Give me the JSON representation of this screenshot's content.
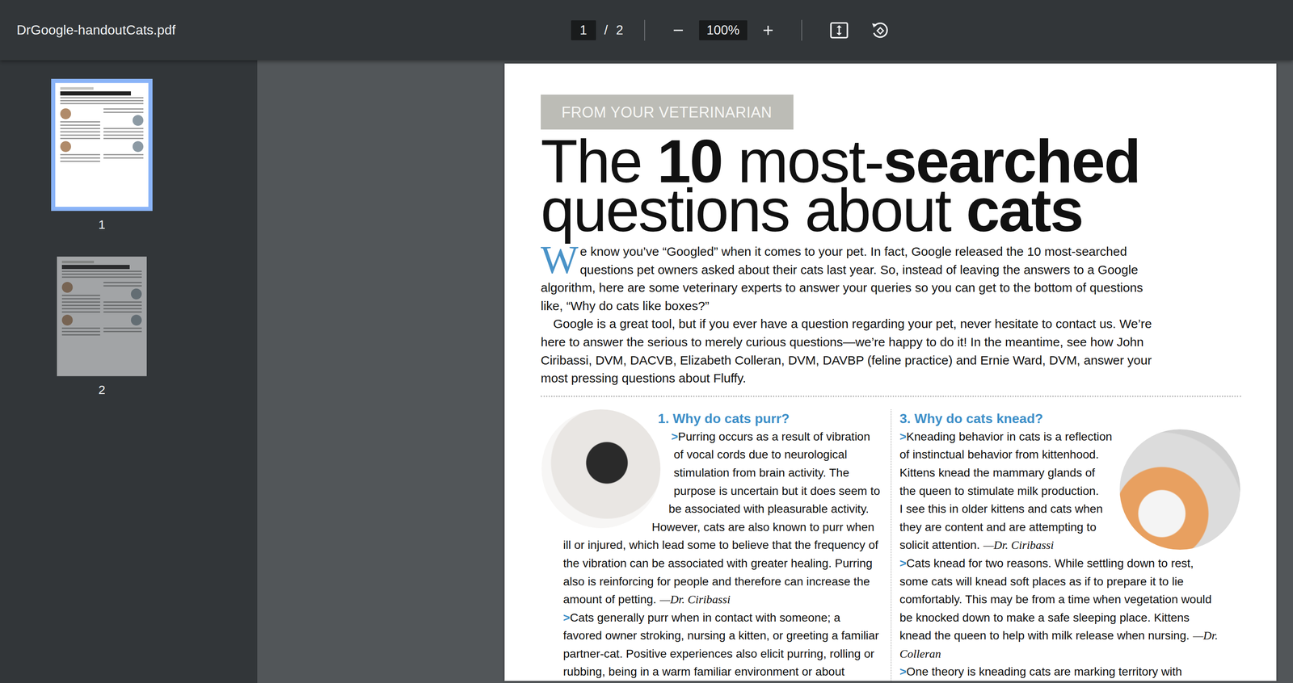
{
  "window": {
    "title": "DrGoogle-handoutCats.pdf"
  },
  "toolbar": {
    "page": "1",
    "page_separator": "/",
    "page_total": "2",
    "zoom": "100%"
  },
  "sidebar": {
    "thumbnails": [
      {
        "label": "1",
        "selected": true
      },
      {
        "label": "2",
        "selected": false
      }
    ]
  },
  "document": {
    "banner": "FROM YOUR VETERINARIAN",
    "title_lines": [
      [
        {
          "text": "The ",
          "bold": false
        },
        {
          "text": "10",
          "bold": true
        },
        {
          "text": " most-",
          "bold": false
        },
        {
          "text": "searched",
          "bold": true
        }
      ],
      [
        {
          "text": "questions about ",
          "bold": false
        },
        {
          "text": "cats",
          "bold": true
        }
      ]
    ],
    "intro": [
      "We know you’ve “Googled” when it comes to your pet. In fact, Google released the 10 most-searched questions pet owners asked about their cats last year. So, instead of leaving the answers to a Google algorithm, here are some veterinary experts to answer your queries so you can get to the bottom of questions like, “Why do cats like boxes?”",
      "Google is a great tool, but if you ever have a question regarding your pet, never hesitate to contact us. We’re here to answer the serious to merely curious questions—we’re happy to do it! In the meantime, see how John Ciribassi, DVM, DACVB, Elizabeth Colleran, DVM, DAVBP (feline practice) and Ernie Ward, DVM, answer your most pressing questions about Fluffy."
    ],
    "columns": [
      {
        "heading": "1. Why do cats purr?",
        "photo_side": "left",
        "answers": [
          {
            "marker": ">",
            "text": "Purring occurs as a result of vibration of vocal cords due to neurological stimulation from brain activity. The purpose is uncertain but it does seem to be associated with pleasurable activity. However, cats are also known to purr when ill or injured, which lead some to believe that the frequency of the vibration can be associated with greater healing. Purring also is reinforcing for people and therefore can increase the amount of petting.",
            "author": "—Dr. Ciribassi"
          },
          {
            "marker": ">",
            "text": "Cats generally purr when in contact with someone; a favored owner stroking, nursing a kitten, or greeting a familiar partner-cat. Positive experiences also elicit purring, rolling or rubbing, being in a warm familiar environment or about",
            "author": ""
          }
        ]
      },
      {
        "heading": "3. Why do cats knead?",
        "photo_side": "right",
        "answers": [
          {
            "marker": ">",
            "text": "Kneading behavior in cats is a reflection of instinctual behavior from kittenhood. Kittens knead the mammary glands of the queen to stimulate milk production. I see this in older kittens and cats when they are content and are attempting to solicit attention.",
            "author": "—Dr. Ciribassi"
          },
          {
            "marker": ">",
            "text": "Cats knead for two reasons. While settling down to rest, some cats will knead soft places as if to prepare it to lie comfortably. This may be from a time when vegetation would be knocked down to make a safe sleeping place. Kittens knead the queen to help with milk release when nursing.",
            "author": "—Dr. Colleran"
          },
          {
            "marker": ">",
            "text": "One theory is kneading cats are marking territory with",
            "author": ""
          }
        ]
      }
    ]
  }
}
